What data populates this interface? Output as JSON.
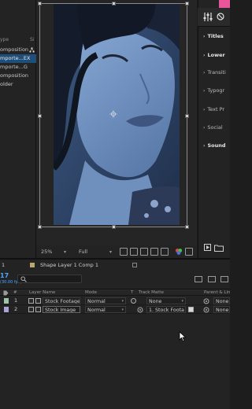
{
  "project_panel": {
    "header": {
      "type_col": "ype",
      "size_col": "Si"
    },
    "items": [
      {
        "label": "omposition",
        "selected": false,
        "icon": "network-icon"
      },
      {
        "label": "mporte...EX",
        "selected": true,
        "icon": ""
      },
      {
        "label": "mporte...G",
        "selected": false,
        "icon": ""
      },
      {
        "label": "omposition",
        "selected": false,
        "icon": ""
      },
      {
        "label": "older",
        "selected": false,
        "icon": ""
      }
    ]
  },
  "viewer_toolbar": {
    "zoom": "25%",
    "resolution": "Full"
  },
  "right_panel": {
    "items": [
      {
        "label": "Titles",
        "bold": true
      },
      {
        "label": "Lower",
        "bold": true
      },
      {
        "label": "Transiti",
        "bold": false
      },
      {
        "label": "Typogr",
        "bold": false
      },
      {
        "label": "Text Pr",
        "bold": false
      },
      {
        "label": "Social",
        "bold": false
      },
      {
        "label": "Sound",
        "bold": true
      }
    ]
  },
  "timeline": {
    "tab_index": "1",
    "tab_label": "Shape Layer 1 Comp 1",
    "timecode": "17",
    "fps": "(30.00 fps)",
    "columns": {
      "num": "#",
      "layer_name": "Layer Name",
      "mode": "Mode",
      "t": "T",
      "track_matte": "Track Matte",
      "parent": "Parent & Link"
    },
    "layers": [
      {
        "num": "1",
        "name": "Stock Footage",
        "mode": "Normal",
        "matte": "None",
        "parent": "None",
        "color": "#9fc3a8"
      },
      {
        "num": "2",
        "name": "Stock Image",
        "mode": "Normal",
        "matte": "1. Stock Foota",
        "parent": "None",
        "color": "#a9a3d6"
      }
    ]
  },
  "colors": {
    "accent_blue": "#4aa8ff",
    "selection": "#1e4e7a",
    "pink_bar": "#e8559a",
    "image_tint": "#4f6d97"
  }
}
